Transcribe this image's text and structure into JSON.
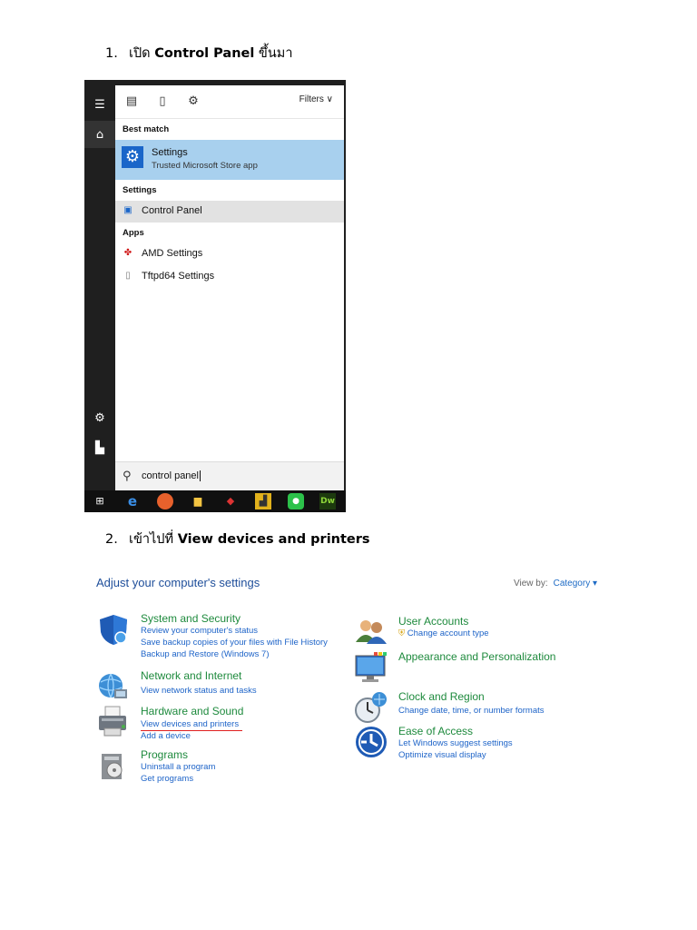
{
  "steps": [
    {
      "num": "1.",
      "pre": "เปิด ",
      "bold": "Control Panel",
      "post": " ขึ้นมา"
    },
    {
      "num": "2.",
      "pre": "เข้าไปที่ ",
      "bold": "View devices and printers",
      "post": ""
    }
  ],
  "start_menu": {
    "filters_label": "Filters",
    "best_match_header": "Best match",
    "best_match": {
      "title": "Settings",
      "subtitle": "Trusted Microsoft Store app",
      "icon": "gear-icon"
    },
    "settings_header": "Settings",
    "settings_items": [
      {
        "label": "Control Panel",
        "icon": "control-panel-icon"
      }
    ],
    "apps_header": "Apps",
    "apps_items": [
      {
        "label": "AMD Settings",
        "icon": "amd-icon"
      },
      {
        "label": "Tftpd64 Settings",
        "icon": "file-icon"
      }
    ],
    "search_value": "control panel"
  },
  "control_panel": {
    "title": "Adjust your computer's settings",
    "view_by_label": "View by:",
    "view_by_value": "Category",
    "left": [
      {
        "title": "System and Security",
        "links": [
          "Review your computer's status",
          "Save backup copies of your files with File History",
          "Backup and Restore (Windows 7)"
        ],
        "icon": "shield-icon"
      },
      {
        "title": "Network and Internet",
        "links": [
          "View network status and tasks"
        ],
        "icon": "globe-icon"
      },
      {
        "title": "Hardware and Sound",
        "links": [
          "View devices and printers",
          "Add a device"
        ],
        "icon": "printer-icon"
      },
      {
        "title": "Programs",
        "links": [
          "Uninstall a program",
          "Get programs"
        ],
        "icon": "programs-icon"
      }
    ],
    "right": [
      {
        "title": "User Accounts",
        "links": [
          "Change account type"
        ],
        "icon": "users-icon"
      },
      {
        "title": "Appearance and Personalization",
        "links": [],
        "icon": "monitor-icon"
      },
      {
        "title": "Clock and Region",
        "links": [
          "Change date, time, or number formats"
        ],
        "icon": "clock-icon"
      },
      {
        "title": "Ease of Access",
        "links": [
          "Let Windows suggest settings",
          "Optimize visual display"
        ],
        "icon": "accessibility-icon"
      }
    ]
  }
}
